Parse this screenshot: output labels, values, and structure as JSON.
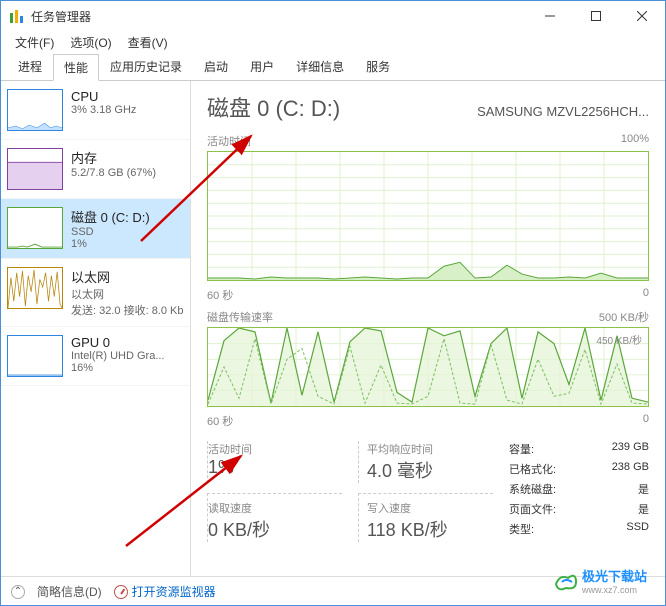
{
  "window": {
    "title": "任务管理器",
    "min": "—",
    "max": "□",
    "close": "×"
  },
  "menu": {
    "file": "文件(F)",
    "options": "选项(O)",
    "view": "查看(V)"
  },
  "tabs": {
    "processes": "进程",
    "performance": "性能",
    "history": "应用历史记录",
    "startup": "启动",
    "users": "用户",
    "details": "详细信息",
    "services": "服务"
  },
  "sidebar": {
    "items": [
      {
        "title": "CPU",
        "sub": "3%  3.18 GHz",
        "border": "#2e86de",
        "fill": "#c4e1ff"
      },
      {
        "title": "内存",
        "sub": "5.2/7.8 GB (67%)",
        "border": "#8040a0",
        "fill": "#e6d0f0"
      },
      {
        "title": "磁盘 0 (C: D:)",
        "sub": "SSD",
        "sub2": "1%",
        "border": "#5aa63a",
        "fill": "#d8f0c8"
      },
      {
        "title": "以太网",
        "sub": "以太网",
        "sub2": "发送: 32.0  接收: 8.0 Kb",
        "border": "#b8860b",
        "fill": "#f0e0b0"
      },
      {
        "title": "GPU 0",
        "sub": "Intel(R) UHD Gra...",
        "sub2": "16%",
        "border": "#2e86de",
        "fill": "#c4e1ff"
      }
    ]
  },
  "main": {
    "title": "磁盘 0 (C: D:)",
    "model": "SAMSUNG MZVL2256HCH...",
    "chart1": {
      "label": "活动时间",
      "max": "100%",
      "xleft": "60 秒",
      "xright": "0"
    },
    "chart2": {
      "label": "磁盘传输速率",
      "max": "500 KB/秒",
      "inner": "450 KB/秒",
      "xleft": "60 秒",
      "xright": "0"
    },
    "stats": {
      "active_label": "活动时间",
      "active_value": "1%",
      "resp_label": "平均响应时间",
      "resp_value": "4.0 毫秒",
      "read_label": "读取速度",
      "read_value": "0 KB/秒",
      "write_label": "写入速度",
      "write_value": "118 KB/秒"
    },
    "info": {
      "capacity_l": "容量:",
      "capacity_v": "239 GB",
      "formatted_l": "已格式化:",
      "formatted_v": "238 GB",
      "system_l": "系统磁盘:",
      "system_v": "是",
      "pagefile_l": "页面文件:",
      "pagefile_v": "是",
      "type_l": "类型:",
      "type_v": "SSD"
    }
  },
  "footer": {
    "brief": "简略信息(D)",
    "monitor": "打开资源监视器"
  },
  "watermark": {
    "site": "极光下载站",
    "url": "www.xz7.com"
  },
  "chart_data": [
    {
      "type": "line",
      "title": "活动时间",
      "xlabel": "60 秒",
      "ylabel": "",
      "ylim": [
        0,
        100
      ],
      "series": [
        {
          "name": "active",
          "values": [
            2,
            2,
            2,
            1,
            3,
            2,
            2,
            2,
            1,
            2,
            3,
            2,
            1,
            2,
            2,
            11,
            14,
            2,
            3,
            12,
            5,
            2,
            2,
            3,
            2,
            6,
            2,
            2,
            2
          ]
        }
      ]
    },
    {
      "type": "line",
      "title": "磁盘传输速率",
      "xlabel": "60 秒",
      "ylabel": "KB/秒",
      "ylim": [
        0,
        500
      ],
      "series": [
        {
          "name": "write",
          "values": [
            40,
            420,
            500,
            475,
            20,
            500,
            70,
            475,
            30,
            410,
            500,
            480,
            90,
            30,
            500,
            450,
            480,
            60,
            400,
            500,
            50,
            475,
            400,
            140,
            500,
            40,
            450,
            50,
            30
          ]
        },
        {
          "name": "read",
          "values": [
            10,
            250,
            50,
            430,
            10,
            300,
            370,
            60,
            10,
            380,
            20,
            260,
            15,
            10,
            60,
            430,
            20,
            10,
            390,
            40,
            10,
            300,
            60,
            80,
            360,
            10,
            270,
            20,
            10
          ]
        }
      ]
    }
  ]
}
